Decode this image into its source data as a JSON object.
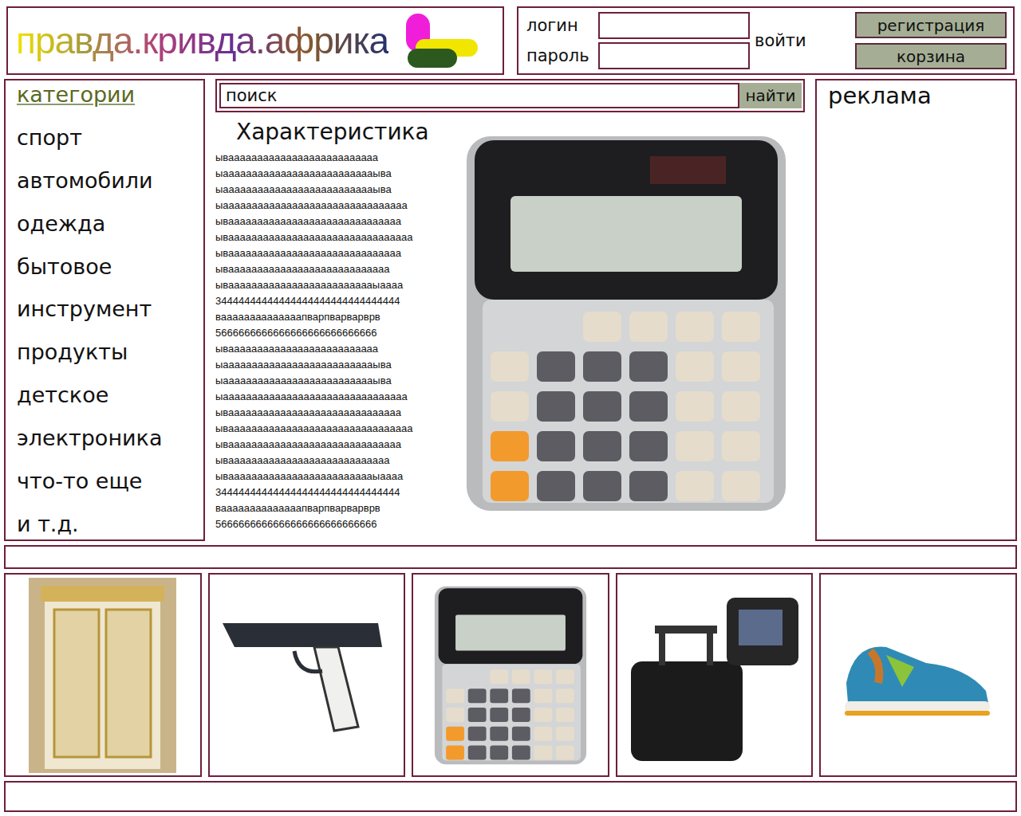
{
  "header": {
    "logo": "правда.кривда.африка",
    "login_label": "логин",
    "password_label": "пароль",
    "login_button": "войти",
    "register_button": "регистрация",
    "cart_button": "корзина"
  },
  "sidebar": {
    "title": "категории",
    "items": [
      "спорт",
      "автомобили",
      "одежда",
      "бытовое",
      "инструмент",
      "продукты",
      "детское",
      "электроника",
      "что-то еще",
      "и т.д."
    ]
  },
  "search": {
    "placeholder": "поиск",
    "button": "найти"
  },
  "product": {
    "heading": "Характеристика",
    "description": [
      "ываааааааааааааааааааааааааа",
      "ыааааааааааааааааааааааааааыва",
      "ыааааааааааааааааааааааааааыва",
      "ыаааааааааааааааааааааааааааааааа",
      "ываааааааааааааааааааааааааааааа",
      "ываааааааааааааааааааааааааааааааа",
      "ываааааааааааааааааааааааааааааа",
      "ываааааааааааааааааааааааааааа",
      "ываааааааааааааааааааааааааыаааа",
      "34444444444444444444444444444444",
      "ваааааааааааааапварпварварврв",
      "5666666666666666666666666666",
      "ываааааааааааааааааааааааааа",
      "ыааааааааааааааааааааааааааыва",
      "ыааааааааааааааааааааааааааыва",
      "ыаааааааааааааааааааааааааааааааа",
      "ываааааааааааааааааааааааааааааа",
      "ываааааааааааааааааааааааааааааааа",
      "ываааааааааааааааааааааааааааааа",
      "ываааааааааааааааааааааааааааа",
      "ываааааааааааааааааааааааааыаааа",
      "34444444444444444444444444444444",
      "ваааааааааааааапварпварварврв",
      "5666666666666666666666666666"
    ]
  },
  "ad": {
    "title": "реклама"
  },
  "gallery": [
    {
      "kind": "wardrobe"
    },
    {
      "kind": "pistol"
    },
    {
      "kind": "calculator"
    },
    {
      "kind": "bags"
    },
    {
      "kind": "sneaker"
    }
  ]
}
